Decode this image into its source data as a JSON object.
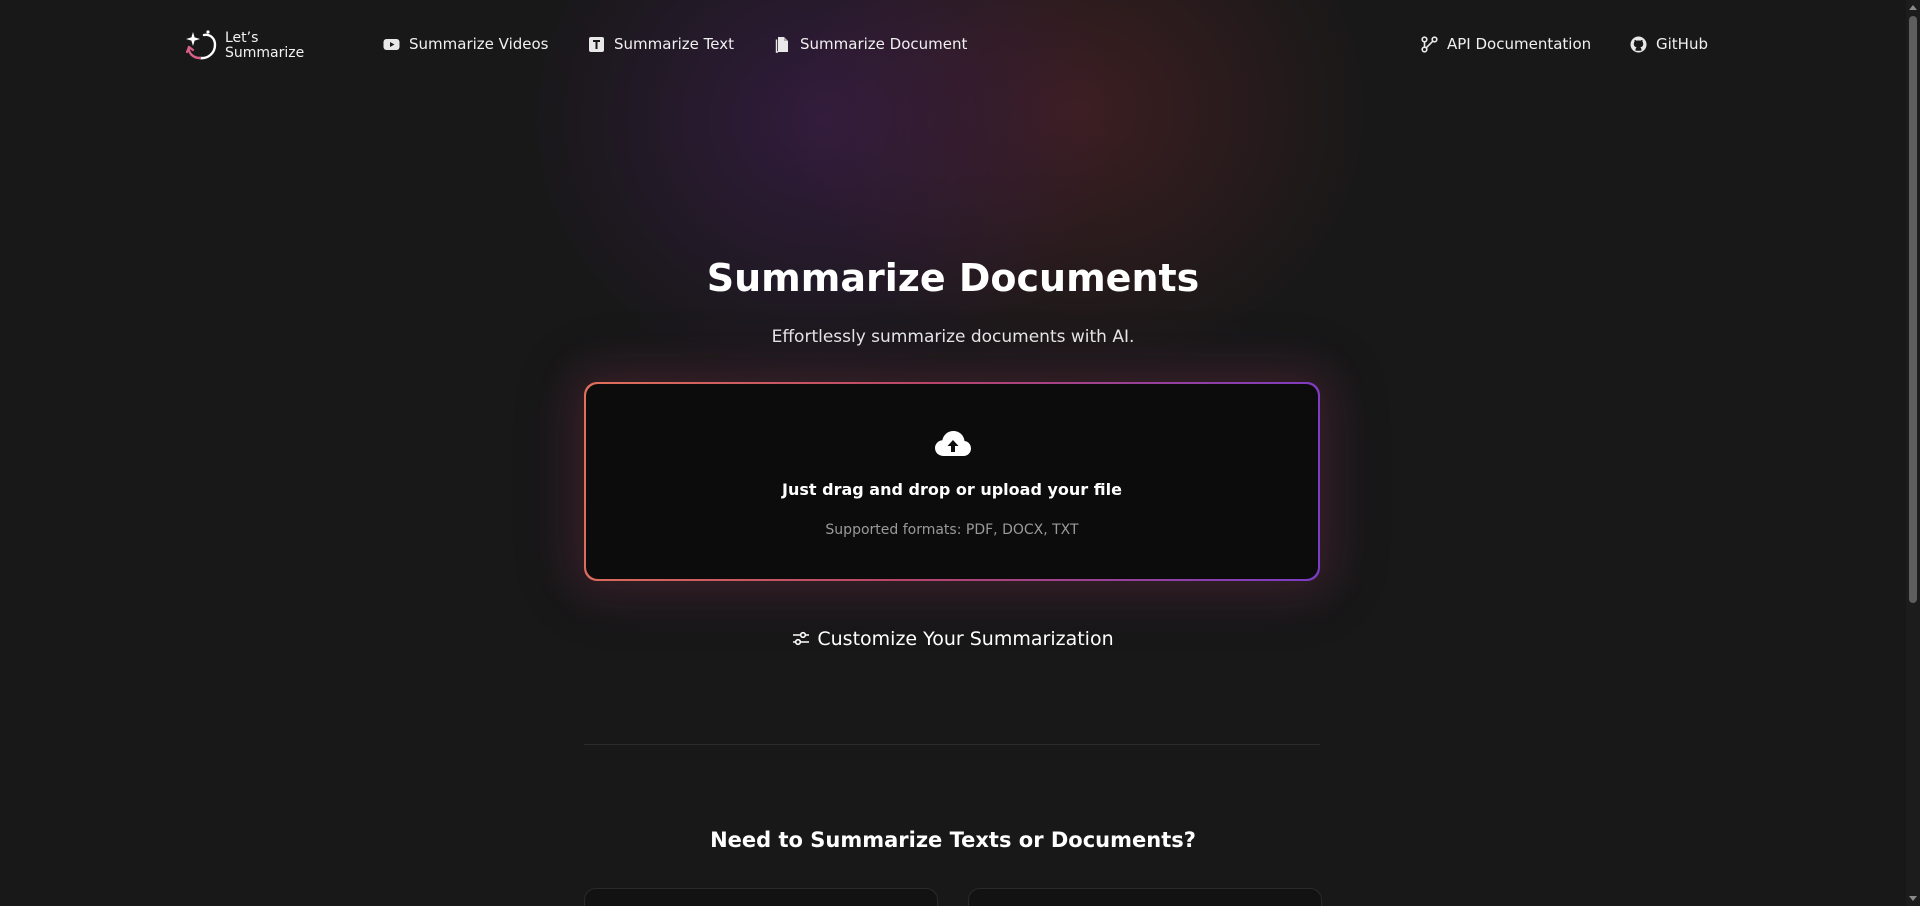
{
  "brand": {
    "line1": "Let’s",
    "line2": "Summarize"
  },
  "nav": {
    "summarize_videos": "Summarize Videos",
    "summarize_text": "Summarize Text",
    "summarize_document": "Summarize Document",
    "api_documentation": "API Documentation",
    "github": "GitHub"
  },
  "hero": {
    "title": "Summarize Documents",
    "subtitle": "Effortlessly summarize documents with AI."
  },
  "dropzone": {
    "title": "Just drag and drop or upload your file",
    "formats": "Supported formats: PDF, DOCX, TXT",
    "icon": "cloud-upload-icon"
  },
  "customize": {
    "label": "Customize Your Summarization",
    "icon": "sliders-icon"
  },
  "section": {
    "title": "Need to Summarize Texts or Documents?"
  },
  "colors": {
    "background": "#181818",
    "dropzone_bg": "#0c0c0c",
    "gradient_start": "#e0705a",
    "gradient_end": "#7a3cc8"
  }
}
